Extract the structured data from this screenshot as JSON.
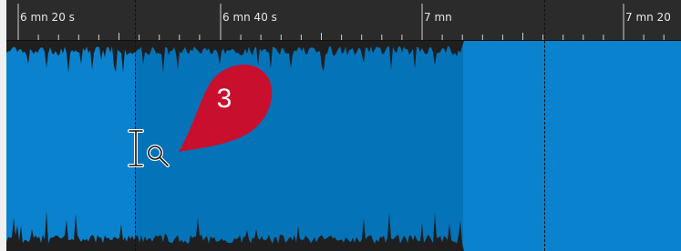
{
  "ruler": {
    "labels": [
      "6 mn 20 s",
      "6 mn 40 s",
      "7 mn",
      "7 mn 20"
    ]
  },
  "callout": {
    "number": "3",
    "color": "#c8102e"
  },
  "colors": {
    "waveform_fill": "#0b82cd",
    "waveform_highlight": "#0473b8",
    "waveform_peak": "#1f1f1f",
    "ruler_bg": "#2b2b2b",
    "ruler_text": "#e6e6e6"
  },
  "icons": {
    "cursor": "zoom-text-cursor-icon"
  }
}
